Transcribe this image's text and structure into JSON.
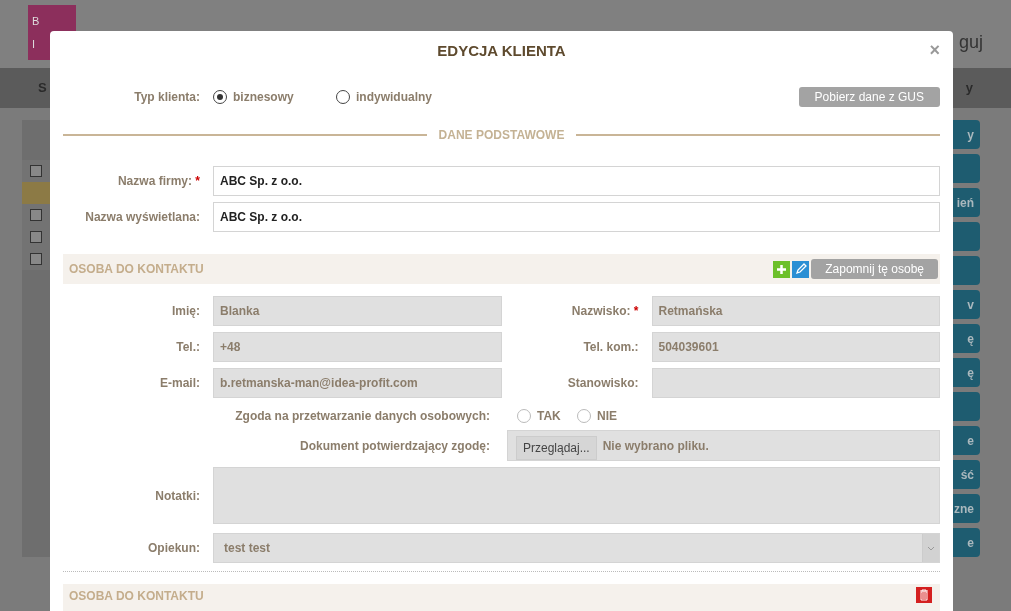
{
  "background": {
    "header": {
      "logo_letters": [
        "B",
        "I"
      ],
      "logout": "guj"
    },
    "nav": {
      "left": "S",
      "right": "y"
    },
    "left_rows": [
      {
        "checked": false,
        "highlight": false
      },
      {
        "highlight": true
      },
      {
        "checked": false,
        "highlight": false
      },
      {
        "checked": false,
        "highlight": false
      },
      {
        "checked": false,
        "highlight": false
      }
    ],
    "side_buttons": [
      {
        "kind": "label",
        "text": "y"
      },
      {
        "kind": "blank"
      },
      {
        "kind": "label",
        "text": "ień"
      },
      {
        "kind": "blank"
      },
      {
        "kind": "blank"
      },
      {
        "kind": "label",
        "text": "v"
      },
      {
        "kind": "label",
        "text": "ę"
      },
      {
        "kind": "label",
        "text": "ę"
      },
      {
        "kind": "blank"
      },
      {
        "kind": "label",
        "text": "e"
      },
      {
        "kind": "label",
        "text": "ść"
      },
      {
        "kind": "label",
        "text": "zne"
      },
      {
        "kind": "label",
        "text": "e"
      }
    ]
  },
  "modal": {
    "title": "EDYCJA KLIENTA",
    "close": "×",
    "required_mark": "*",
    "client_type": {
      "label": "Typ klienta:",
      "options": [
        {
          "label": "biznesowy",
          "selected": true
        },
        {
          "label": "indywidualny",
          "selected": false
        }
      ]
    },
    "gus_button": "Pobierz dane z GUS",
    "section_title": "DANE PODSTAWOWE",
    "fields": [
      {
        "label": "Nazwa firmy:",
        "required": true,
        "value": "ABC Sp. z o.o."
      },
      {
        "label": "Nazwa wyświetlana:",
        "required": false,
        "value": "ABC Sp. z o.o."
      }
    ],
    "contact": {
      "header": "OSOBA DO KONTAKTU",
      "forget_button": "Zapomnij tę osobę",
      "fields": [
        {
          "label": "Imię:",
          "required": false,
          "value": "Blanka"
        },
        {
          "label": "Nazwisko:",
          "required": true,
          "value": "Retmańska"
        },
        {
          "label": "Tel.:",
          "required": false,
          "value": "+48"
        },
        {
          "label": "Tel. kom.:",
          "required": false,
          "value": "504039601"
        },
        {
          "label": "E-mail:",
          "required": false,
          "value": "b.retmanska-man@idea-profit.com"
        },
        {
          "label": "Stanowisko:",
          "required": false
        }
      ],
      "consent": {
        "label": "Zgoda na przetwarzanie danych osobowych:",
        "options": [
          {
            "label": "TAK",
            "selected": false
          },
          {
            "label": "NIE",
            "selected": false
          }
        ]
      },
      "document": {
        "label": "Dokument potwierdzający zgodę:",
        "browse_button": "Przeglądaj...",
        "file_status": "Nie wybrano pliku."
      },
      "notes": {
        "label": "Notatki:"
      },
      "guardian": {
        "label": "Opiekun:",
        "value": "test test"
      }
    },
    "second_contact": {
      "header": "OSOBA DO KONTAKTU"
    }
  }
}
